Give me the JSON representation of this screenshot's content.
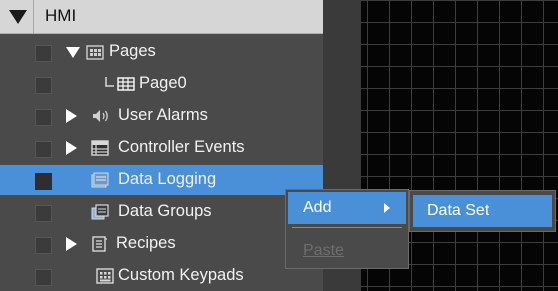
{
  "tree": {
    "root": {
      "label": "HMI",
      "icon": "triangle-down-icon"
    },
    "items": [
      {
        "label": "Pages",
        "icon": "pages-folder-icon",
        "expander": "expanded"
      },
      {
        "label": "Page0",
        "icon": "page-grid-icon",
        "expander": "none"
      },
      {
        "label": "User Alarms",
        "icon": "speaker-icon",
        "expander": "collapsed"
      },
      {
        "label": "Controller Events",
        "icon": "events-table-icon",
        "expander": "collapsed"
      },
      {
        "label": "Data Logging",
        "icon": "data-logging-icon",
        "expander": "none",
        "selected": true
      },
      {
        "label": "Data Groups",
        "icon": "data-groups-icon",
        "expander": "none"
      },
      {
        "label": "Recipes",
        "icon": "recipes-icon",
        "expander": "collapsed"
      },
      {
        "label": "Custom Keypads",
        "icon": "keypad-icon",
        "expander": "none"
      }
    ]
  },
  "context_menu": {
    "items": [
      {
        "label": "Add",
        "has_submenu": true,
        "highlighted": true
      },
      {
        "label": "Paste",
        "disabled": true
      }
    ]
  },
  "submenu": {
    "items": [
      {
        "label": "Data Set",
        "highlighted": true
      }
    ]
  },
  "colors": {
    "selection": "#4a90d9",
    "panel": "#4a4a4a",
    "header": "#d6d6d6",
    "canvas": "#050505"
  }
}
